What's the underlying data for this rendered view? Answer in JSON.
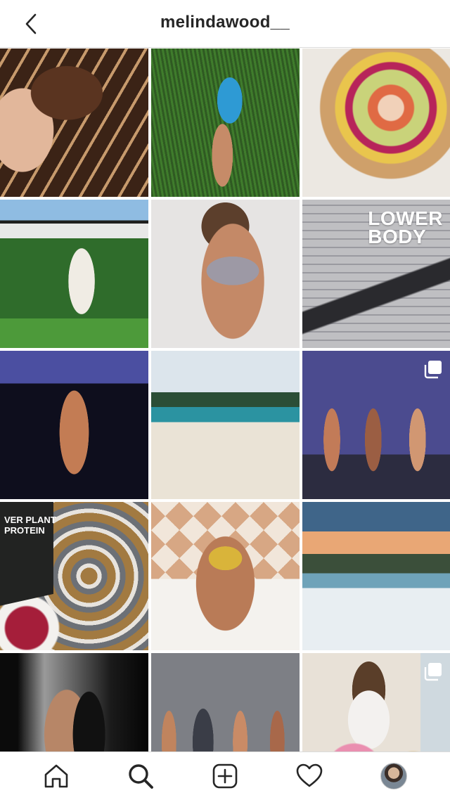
{
  "header": {
    "title": "melindawood__",
    "back_icon": "chevron-left-icon"
  },
  "grid": {
    "tiles": [
      {
        "id": "tile-1",
        "subject": "cookie-dough-bar",
        "colors": [
          "#b07a4c",
          "#4c2a19",
          "#e8d0b4"
        ]
      },
      {
        "id": "tile-2",
        "subject": "blue-swimsuit-on-grass",
        "colors": [
          "#325e23",
          "#4a8a34",
          "#2e9ad4"
        ]
      },
      {
        "id": "tile-3",
        "subject": "poke-bowl",
        "colors": [
          "#d2a26b",
          "#b9c67b",
          "#e16b46"
        ]
      },
      {
        "id": "tile-4",
        "subject": "garden-outfit",
        "colors": [
          "#6fa5d7",
          "#2d6a2b",
          "#a7c8e8"
        ]
      },
      {
        "id": "tile-5",
        "subject": "grey-bikini-portrait",
        "colors": [
          "#e4e2e1",
          "#c3886a",
          "#b8b3c0"
        ]
      },
      {
        "id": "tile-6",
        "subject": "gym-leg-press",
        "colors": [
          "#c8c8ca",
          "#7c7c80",
          "#2b2b2f"
        ],
        "overlay_text": [
          "LOWER",
          "BODY"
        ]
      },
      {
        "id": "tile-7",
        "subject": "stage-pose-purple",
        "colors": [
          "#3a3f8c",
          "#0e0e1d",
          "#c37c54"
        ]
      },
      {
        "id": "tile-8",
        "subject": "beach-handstand",
        "colors": [
          "#dfe6eb",
          "#2a8f9c",
          "#ebe3d5"
        ]
      },
      {
        "id": "tile-9",
        "subject": "competition-lineup",
        "colors": [
          "#6c6ab6",
          "#4a4a92",
          "#c27b58"
        ],
        "multi": true
      },
      {
        "id": "tile-10",
        "subject": "protein-muffins",
        "colors": [
          "#e8e5e0",
          "#a67b3f",
          "#232423"
        ],
        "overlay_text": [
          "VER PLANT",
          "PROTEIN"
        ]
      },
      {
        "id": "tile-11",
        "subject": "yellow-bikini-tiles",
        "colors": [
          "#d9b08a",
          "#f2e7dc",
          "#d9b43a"
        ]
      },
      {
        "id": "tile-12",
        "subject": "sunset-beach-walk",
        "colors": [
          "#3c5f86",
          "#f0b479",
          "#e8edf0"
        ]
      },
      {
        "id": "tile-13",
        "subject": "black-bodysuit",
        "colors": [
          "#0d0d0d",
          "#7a7a7a",
          "#c08c6d"
        ]
      },
      {
        "id": "tile-14",
        "subject": "award-ceremony",
        "colors": [
          "#7d7f85",
          "#c0c4c8",
          "#3d3b44"
        ]
      },
      {
        "id": "tile-15",
        "subject": "cafe-meal",
        "colors": [
          "#e9e2d8",
          "#bfa27f",
          "#d86a2c"
        ],
        "multi": true
      }
    ]
  },
  "tabbar": {
    "items": [
      {
        "name": "home",
        "icon": "home-icon"
      },
      {
        "name": "search",
        "icon": "search-icon",
        "active": true
      },
      {
        "name": "new-post",
        "icon": "plus-square-icon"
      },
      {
        "name": "activity",
        "icon": "heart-icon"
      },
      {
        "name": "profile",
        "icon": "avatar"
      }
    ]
  },
  "colors": {
    "text": "#262626",
    "border": "#dbdbdb",
    "background": "#ffffff"
  }
}
